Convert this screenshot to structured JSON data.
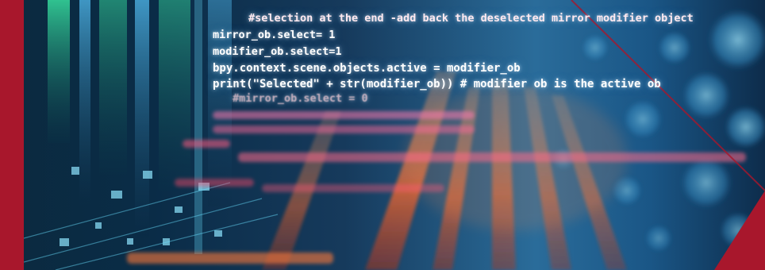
{
  "colors": {
    "brand_red": "#a8172c",
    "glow_orange": "#ff6a2a",
    "glow_cyan": "#5fd8ff",
    "background": "#0a1a2e"
  },
  "code_lines": [
    "#selection at the end -add back the deselected mirror modifier object",
    "mirror_ob.select= 1",
    "modifier_ob.select=1",
    "bpy.context.scene.objects.active = modifier_ob",
    "print(\"Selected\" + str(modifier_ob)) # modifier ob is the active ob",
    "#mirror_ob.select = 0"
  ]
}
